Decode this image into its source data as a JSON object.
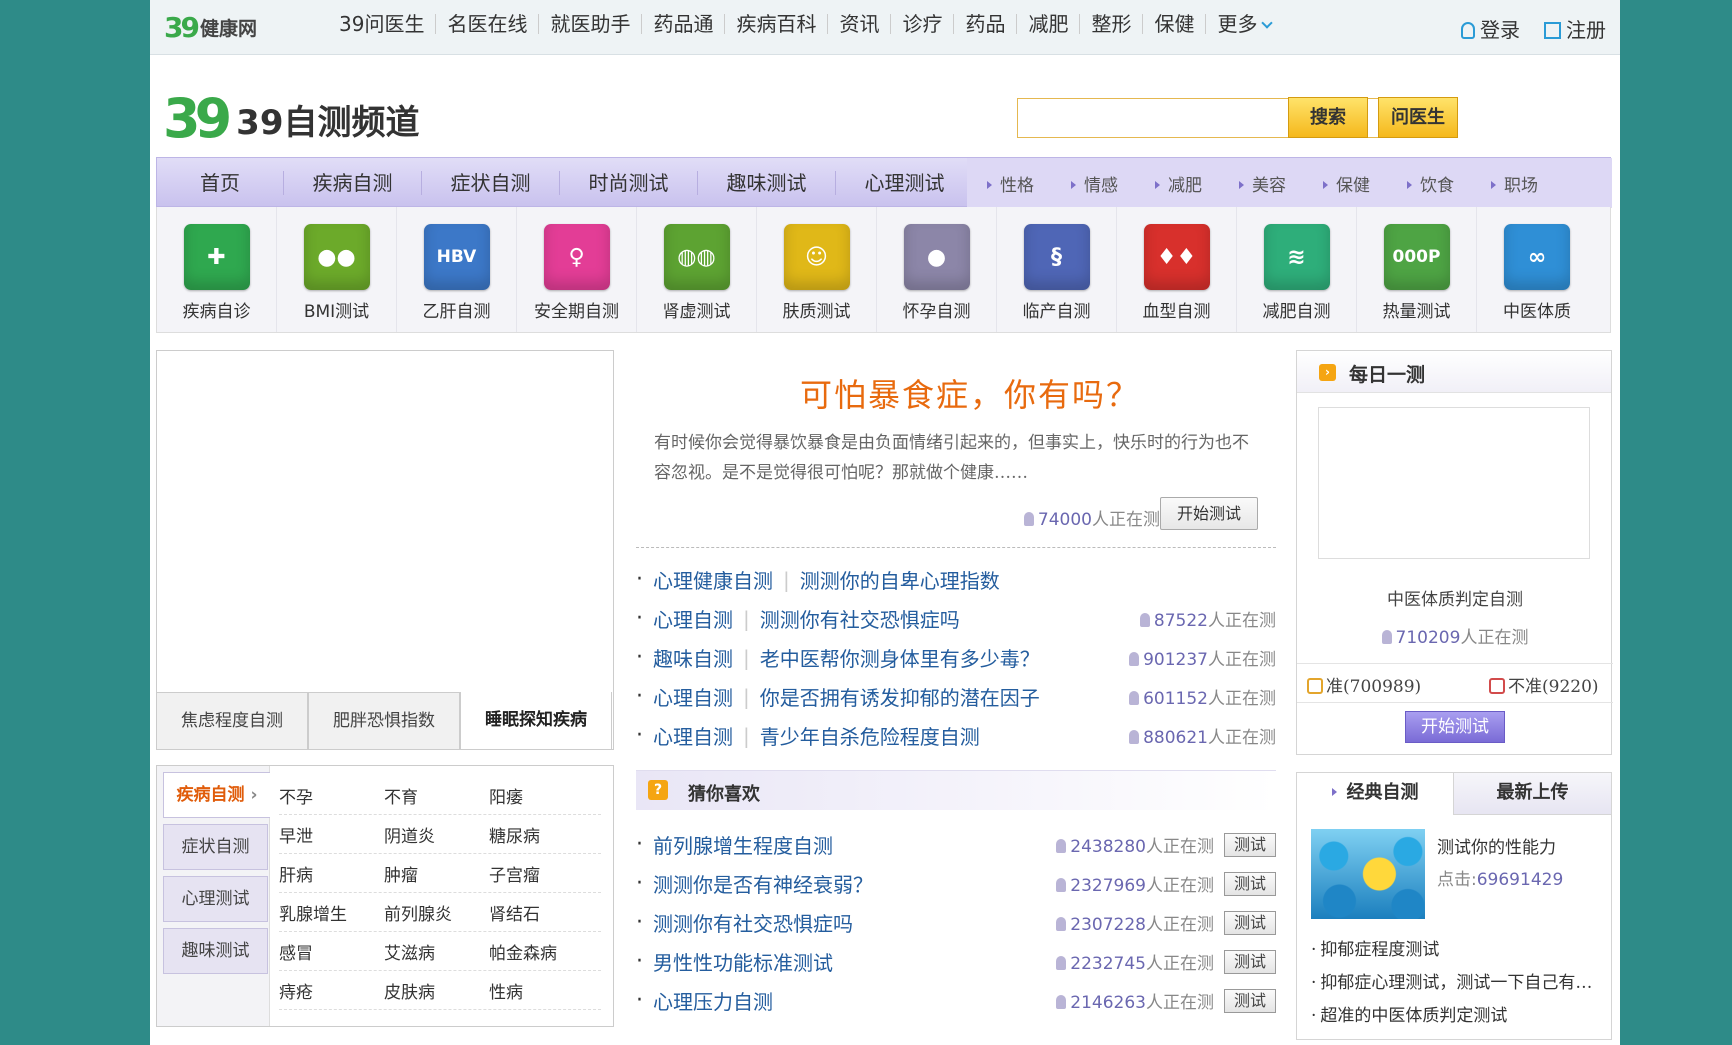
{
  "topbar": {
    "logo_num": "39",
    "logo_text": "健康网",
    "nav": [
      "39问医生",
      "名医在线",
      "就医助手",
      "药品通",
      "疾病百科",
      "资讯",
      "诊疗",
      "药品",
      "减肥",
      "整形",
      "保健",
      "更多"
    ],
    "login": "登录",
    "register": "注册"
  },
  "header": {
    "logo_num": "39",
    "logo_text": "39自测频道",
    "search_placeholder": "",
    "search_button": "搜索",
    "ask_button": "问医生"
  },
  "nav": {
    "main": [
      "首页",
      "疾病自测",
      "症状自测",
      "时尚测试",
      "趣味测试",
      "心理测试"
    ],
    "sub": [
      "性格",
      "情感",
      "减肥",
      "美容",
      "保健",
      "饮食",
      "职场"
    ]
  },
  "icons": [
    {
      "label": "疾病自诊",
      "glyph": "✚",
      "color": "#2fa84f"
    },
    {
      "label": "BMI测试",
      "glyph": "●●",
      "color": "#6caa2a"
    },
    {
      "label": "乙肝自测",
      "glyph": "HBV",
      "color": "#3c78c8"
    },
    {
      "label": "安全期自测",
      "glyph": "♀",
      "color": "#e33d96"
    },
    {
      "label": "肾虚测试",
      "glyph": "◍◍",
      "color": "#5da332"
    },
    {
      "label": "肤质测试",
      "glyph": "☺",
      "color": "#e0b818"
    },
    {
      "label": "怀孕自测",
      "glyph": "●",
      "color": "#8c86a8"
    },
    {
      "label": "临产自测",
      "glyph": "§",
      "color": "#4f66b6"
    },
    {
      "label": "血型自测",
      "glyph": "♦♦",
      "color": "#d8302c"
    },
    {
      "label": "减肥自测",
      "glyph": "≋",
      "color": "#2eae7a"
    },
    {
      "label": "热量测试",
      "glyph": "000P",
      "color": "#4ea444"
    },
    {
      "label": "中医体质",
      "glyph": "∞",
      "color": "#2f8fd6"
    }
  ],
  "left": {
    "tabs": [
      "焦虑程度自测",
      "肥胖恐惧指数",
      "睡眠探知疾病"
    ],
    "categories": [
      "疾病自测",
      "症状自测",
      "心理测试",
      "趣味测试"
    ],
    "diseases": [
      [
        "不孕",
        "不育",
        "阳痿"
      ],
      [
        "早泄",
        "阴道炎",
        "糖尿病"
      ],
      [
        "肝病",
        "肿瘤",
        "子宫瘤"
      ],
      [
        "乳腺增生",
        "前列腺炎",
        "肾结石"
      ],
      [
        "感冒",
        "艾滋病",
        "帕金森病"
      ],
      [
        "痔疮",
        "皮肤病",
        "性病"
      ]
    ]
  },
  "main": {
    "title": "可怕暴食症，你有吗？",
    "desc": "有时候你会觉得暴饮暴食是由负面情绪引起来的，但事实上，快乐时的行为也不容忽视。是不是觉得很可怕呢？那就做个健康……",
    "count": "74000",
    "count_suffix": "人正在测",
    "start": "开始测试",
    "list": [
      {
        "cat": "心理健康自测",
        "title": "测测你的自卑心理指数",
        "count": ""
      },
      {
        "cat": "心理自测",
        "title": "测测你有社交恐惧症吗",
        "count": "87522"
      },
      {
        "cat": "趣味自测",
        "title": "老中医帮你测身体里有多少毒？",
        "count": "901237"
      },
      {
        "cat": "心理自测",
        "title": "你是否拥有诱发抑郁的潜在因子",
        "count": "601152"
      },
      {
        "cat": "心理自测",
        "title": "青少年自杀危险程度自测",
        "count": "880621"
      }
    ],
    "guess_title": "猜你喜欢",
    "guess_icon": "?",
    "guess": [
      {
        "title": "前列腺增生程度自测",
        "count": "2438280"
      },
      {
        "title": "测测你是否有神经衰弱？",
        "count": "2327969"
      },
      {
        "title": "测测你有社交恐惧症吗",
        "count": "2307228"
      },
      {
        "title": "男性性功能标准测试",
        "count": "2232745"
      },
      {
        "title": "心理压力自测",
        "count": "2146263"
      }
    ],
    "test_btn": "测试"
  },
  "right": {
    "daily_title": "每日一测",
    "daily_icon": "›",
    "daily_name": "中医体质判定自测",
    "daily_count": "710209",
    "yes": "准(700989)",
    "no": "不准(9220)",
    "start": "开始测试",
    "tabs": [
      "经典自测",
      "最新上传"
    ],
    "feat_title": "测试你的性能力",
    "feat_click": "点击:",
    "feat_count": "69691429",
    "links": [
      "抑郁症程度测试",
      "抑郁症心理测试，测试一下自己有没有抑郁症",
      "超准的中医体质判定测试"
    ]
  }
}
